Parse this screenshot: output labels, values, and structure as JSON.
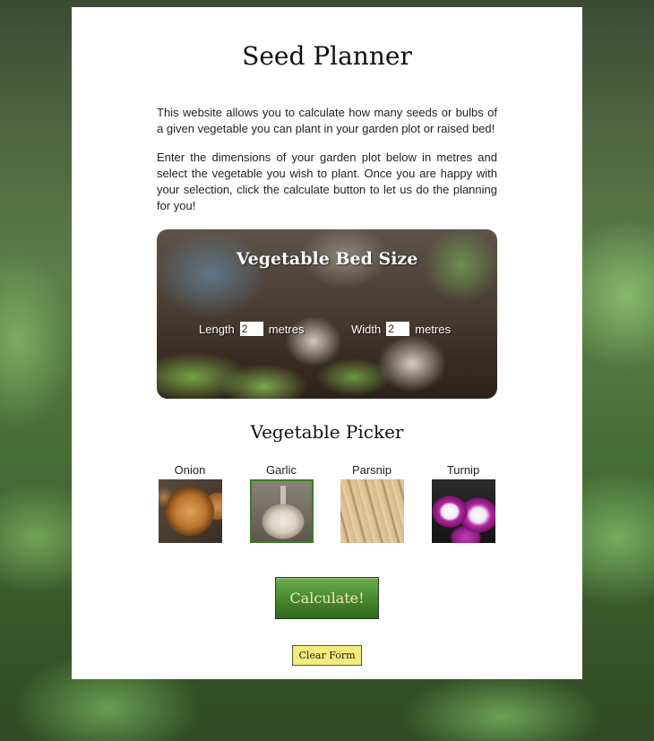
{
  "page": {
    "title": "Seed Planner",
    "intro_1": "This website allows you to calculate how many seeds or bulbs of a given vegetable you can plant in your garden plot or raised bed!",
    "intro_2": "Enter the dimensions of your garden plot below in metres and select the vegetable you wish to plant. Once you are happy with your selection, click the calculate button to let us do the planning for you!"
  },
  "bed_size": {
    "title": "Vegetable Bed Size",
    "length_label": "Length",
    "length_value": "2",
    "width_label": "Width",
    "width_value": "2",
    "unit": "metres"
  },
  "picker": {
    "title": "Vegetable Picker",
    "vegetables": [
      {
        "label": "Onion",
        "icon": "onion-photo",
        "selected": false
      },
      {
        "label": "Garlic",
        "icon": "garlic-photo",
        "selected": true
      },
      {
        "label": "Parsnip",
        "icon": "parsnip-photo",
        "selected": false
      },
      {
        "label": "Turnip",
        "icon": "turnip-photo",
        "selected": false
      }
    ]
  },
  "actions": {
    "calculate_label": "Calculate!",
    "clear_label": "Clear Form"
  },
  "colors": {
    "calculate_button": "#4b8d32",
    "calculate_text": "#f1e8b0",
    "clear_button": "#f3ec7a",
    "selected_border": "#3d7a25"
  }
}
